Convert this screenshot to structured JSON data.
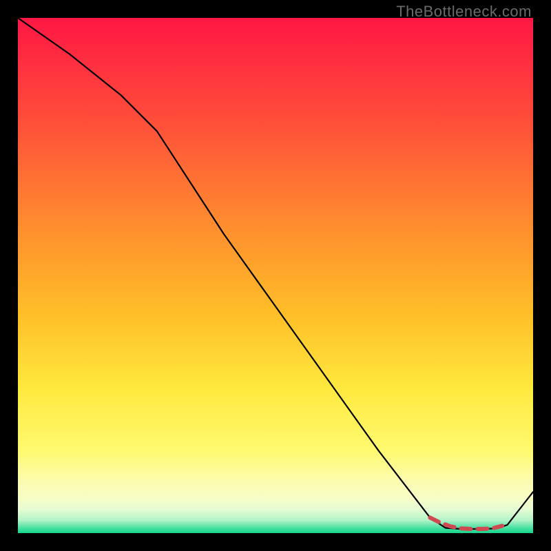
{
  "watermark": "TheBottleneck.com",
  "chart_data": {
    "type": "line",
    "title": "",
    "xlabel": "",
    "ylabel": "",
    "xlim": [
      0,
      100
    ],
    "ylim": [
      0,
      100
    ],
    "grid": false,
    "legend": false,
    "background": {
      "type": "vertical-gradient",
      "stops": [
        {
          "pos": 0.0,
          "color": "#ff1744"
        },
        {
          "pos": 0.2,
          "color": "#ff4e3a"
        },
        {
          "pos": 0.4,
          "color": "#ff8c2f"
        },
        {
          "pos": 0.58,
          "color": "#ffc028"
        },
        {
          "pos": 0.72,
          "color": "#ffe93f"
        },
        {
          "pos": 0.84,
          "color": "#fffa70"
        },
        {
          "pos": 0.9,
          "color": "#fcfcb0"
        },
        {
          "pos": 0.935,
          "color": "#f6fdc8"
        },
        {
          "pos": 0.955,
          "color": "#e4fbd3"
        },
        {
          "pos": 0.975,
          "color": "#b3f3c8"
        },
        {
          "pos": 0.99,
          "color": "#47e0a0"
        },
        {
          "pos": 1.0,
          "color": "#17d78e"
        }
      ]
    },
    "series": [
      {
        "name": "curve",
        "color": "#000000",
        "width": 2.2,
        "x": [
          0,
          10,
          20,
          27,
          40,
          55,
          70,
          80,
          83,
          86,
          90,
          93,
          95,
          100
        ],
        "y": [
          100,
          93,
          85,
          78,
          58,
          37,
          16,
          3,
          1,
          0.8,
          0.8,
          0.9,
          1.6,
          8
        ]
      },
      {
        "name": "highlight",
        "color": "#cf4a52",
        "width": 6,
        "dash": true,
        "x": [
          80,
          82,
          84,
          86,
          88,
          90,
          92,
          94
        ],
        "y": [
          3.0,
          2.0,
          1.3,
          0.9,
          0.8,
          0.8,
          0.9,
          1.4
        ]
      }
    ]
  }
}
